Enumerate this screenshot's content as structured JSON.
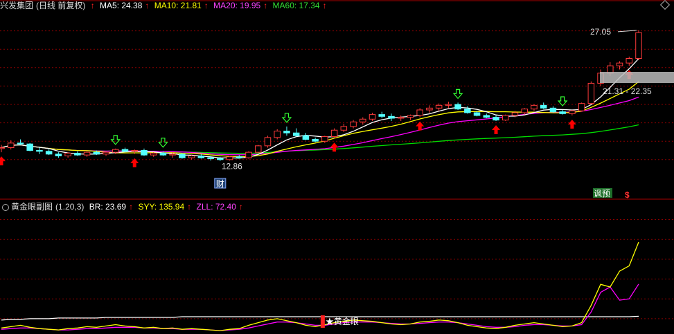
{
  "main_header": {
    "title": "兴发集团",
    "subtitle": "(日线 前复权)",
    "ma5_label": "MA5: 24.38",
    "ma10_label": "MA10: 21.81",
    "ma20_label": "MA20: 19.95",
    "ma60_label": "MA60: 17.34",
    "up_arrow": "↑"
  },
  "sub_header": {
    "title": "黄金眼副图",
    "params": "(1.20,3)",
    "br_label": "BR: 23.69",
    "syy_label": "SYY: 135.94",
    "zll_label": "ZLL: 72.40",
    "up_arrow": "↑"
  },
  "colors": {
    "background": "#000000",
    "grid": "#8b0000",
    "up_candle": "#ff3b3b",
    "down_candle": "#54ffff",
    "ma5": "#ffffff",
    "ma10": "#ffff00",
    "ma20": "#ff00ff",
    "ma60": "#00dd00",
    "buy_arrow": "#ff0000",
    "sell_arrow": "#33ff33"
  },
  "annotations": {
    "high_price": "27.05",
    "low_price": "12.86",
    "range_box": "21.31 - 22.35",
    "finance_marker": "财",
    "badge_forecast": "讽预",
    "badge_dollar": "$",
    "golden_eye_label": "黄金眼"
  },
  "chart_data": [
    {
      "type": "candlestick",
      "title": "兴发集团 (日线 前复权)",
      "ylim": [
        9,
        29
      ],
      "candles": [
        [
          14.2,
          14.6,
          13.8,
          14.3
        ],
        [
          14.3,
          15.1,
          14.1,
          14.8
        ],
        [
          14.8,
          15.2,
          14.6,
          14.7
        ],
        [
          14.7,
          14.8,
          13.9,
          14.0
        ],
        [
          14.0,
          14.3,
          13.6,
          13.9
        ],
        [
          13.9,
          14.1,
          13.5,
          13.6
        ],
        [
          13.6,
          13.8,
          13.2,
          13.4
        ],
        [
          13.4,
          13.8,
          13.2,
          13.7
        ],
        [
          13.7,
          13.9,
          13.4,
          13.5
        ],
        [
          13.5,
          13.9,
          13.3,
          13.8
        ],
        [
          13.8,
          14.0,
          13.5,
          13.6
        ],
        [
          13.6,
          13.9,
          13.4,
          13.8
        ],
        [
          13.8,
          14.2,
          13.6,
          14.1
        ],
        [
          14.1,
          14.3,
          13.8,
          13.9
        ],
        [
          13.9,
          14.1,
          13.6,
          14.0
        ],
        [
          14.0,
          14.2,
          13.4,
          13.5
        ],
        [
          13.5,
          13.8,
          13.3,
          13.7
        ],
        [
          13.7,
          13.9,
          13.4,
          13.5
        ],
        [
          13.5,
          13.8,
          13.2,
          13.6
        ],
        [
          13.6,
          13.7,
          13.1,
          13.2
        ],
        [
          13.2,
          13.5,
          13.0,
          13.4
        ],
        [
          13.4,
          13.6,
          13.1,
          13.2
        ],
        [
          13.2,
          13.4,
          12.9,
          13.1
        ],
        [
          13.1,
          13.3,
          12.86,
          13.0
        ],
        [
          13.0,
          13.4,
          12.9,
          13.3
        ],
        [
          13.3,
          13.5,
          13.1,
          13.2
        ],
        [
          13.2,
          13.9,
          13.1,
          13.8
        ],
        [
          13.8,
          14.6,
          13.7,
          14.5
        ],
        [
          14.5,
          15.6,
          14.3,
          15.4
        ],
        [
          15.4,
          16.3,
          15.2,
          16.1
        ],
        [
          16.1,
          16.6,
          15.6,
          15.9
        ],
        [
          15.9,
          16.4,
          15.5,
          15.6
        ],
        [
          15.6,
          15.9,
          15.1,
          15.2
        ],
        [
          15.2,
          15.4,
          14.9,
          15.0
        ],
        [
          15.0,
          15.6,
          14.8,
          15.5
        ],
        [
          15.5,
          16.4,
          15.3,
          16.2
        ],
        [
          16.2,
          16.9,
          16.0,
          16.6
        ],
        [
          16.6,
          17.3,
          16.4,
          17.1
        ],
        [
          17.1,
          17.6,
          16.8,
          17.4
        ],
        [
          17.4,
          18.1,
          17.2,
          17.9
        ],
        [
          17.9,
          18.2,
          17.5,
          17.7
        ],
        [
          17.7,
          18.0,
          17.2,
          17.5
        ],
        [
          17.5,
          17.8,
          17.2,
          17.6
        ],
        [
          17.6,
          17.9,
          17.3,
          17.8
        ],
        [
          17.8,
          18.6,
          17.6,
          18.4
        ],
        [
          18.4,
          18.9,
          18.1,
          18.6
        ],
        [
          18.6,
          19.1,
          18.3,
          18.9
        ],
        [
          18.9,
          19.3,
          18.6,
          19.0
        ],
        [
          19.0,
          19.2,
          18.4,
          18.5
        ],
        [
          18.5,
          18.8,
          18.0,
          18.1
        ],
        [
          18.1,
          18.3,
          17.7,
          17.8
        ],
        [
          17.8,
          18.0,
          17.5,
          17.6
        ],
        [
          17.6,
          17.8,
          17.2,
          17.3
        ],
        [
          17.3,
          17.9,
          17.2,
          17.8
        ],
        [
          17.8,
          18.3,
          17.6,
          18.1
        ],
        [
          18.1,
          18.6,
          17.9,
          18.5
        ],
        [
          18.5,
          19.0,
          18.3,
          18.9
        ],
        [
          18.9,
          19.2,
          18.5,
          18.6
        ],
        [
          18.6,
          18.8,
          18.1,
          18.2
        ],
        [
          18.2,
          18.4,
          17.9,
          18.0
        ],
        [
          18.0,
          18.4,
          17.8,
          18.3
        ],
        [
          18.3,
          19.2,
          18.2,
          19.1
        ],
        [
          19.1,
          21.5,
          19.0,
          21.3
        ],
        [
          21.3,
          22.8,
          21.0,
          22.4
        ],
        [
          22.4,
          23.6,
          22.1,
          23.2
        ],
        [
          23.2,
          23.7,
          22.8,
          23.5
        ],
        [
          23.5,
          24.2,
          23.2,
          24.0
        ],
        [
          24.0,
          27.05,
          23.8,
          26.8
        ]
      ]
    },
    {
      "type": "line",
      "title": "黄金眼副图 (1.20,3)",
      "ylim": [
        0,
        180
      ],
      "series": [
        {
          "name": "BR",
          "values": [
            18,
            19,
            19,
            20,
            20,
            20,
            21,
            21,
            21,
            21,
            21,
            22,
            22,
            22,
            22,
            22,
            22,
            22,
            22,
            23,
            23,
            23,
            23,
            23,
            23,
            23,
            23,
            23,
            23,
            23,
            23,
            23,
            23,
            23,
            23,
            23,
            23,
            23,
            23,
            23,
            23,
            23,
            23,
            23,
            23,
            23,
            23,
            23,
            23,
            23,
            23,
            23,
            23,
            23,
            23,
            23,
            23,
            23,
            23,
            23,
            23,
            23,
            23,
            23,
            23,
            23,
            23,
            23.69
          ]
        },
        {
          "name": "SYY",
          "values": [
            6,
            8,
            10,
            7,
            5,
            4,
            3,
            5,
            6,
            8,
            7,
            9,
            11,
            9,
            8,
            6,
            7,
            5,
            6,
            4,
            5,
            4,
            3,
            2,
            4,
            5,
            10,
            14,
            18,
            20,
            17,
            14,
            10,
            8,
            11,
            14,
            16,
            18,
            17,
            16,
            14,
            12,
            11,
            12,
            15,
            16,
            18,
            17,
            14,
            10,
            8,
            6,
            5,
            7,
            10,
            12,
            14,
            12,
            10,
            8,
            9,
            14,
            40,
            72,
            68,
            92,
            100,
            135.94
          ]
        },
        {
          "name": "ZLL",
          "values": [
            4,
            5,
            6,
            6,
            5,
            4,
            3,
            3,
            4,
            5,
            5,
            6,
            7,
            7,
            7,
            6,
            6,
            5,
            5,
            4,
            4,
            4,
            3,
            2,
            3,
            4,
            6,
            9,
            12,
            15,
            15,
            14,
            12,
            10,
            10,
            12,
            14,
            15,
            15,
            15,
            14,
            13,
            12,
            12,
            13,
            14,
            15,
            15,
            14,
            12,
            10,
            8,
            7,
            7,
            8,
            10,
            11,
            11,
            10,
            9,
            9,
            11,
            30,
            60,
            68,
            48,
            50,
            72.4
          ]
        }
      ]
    }
  ]
}
